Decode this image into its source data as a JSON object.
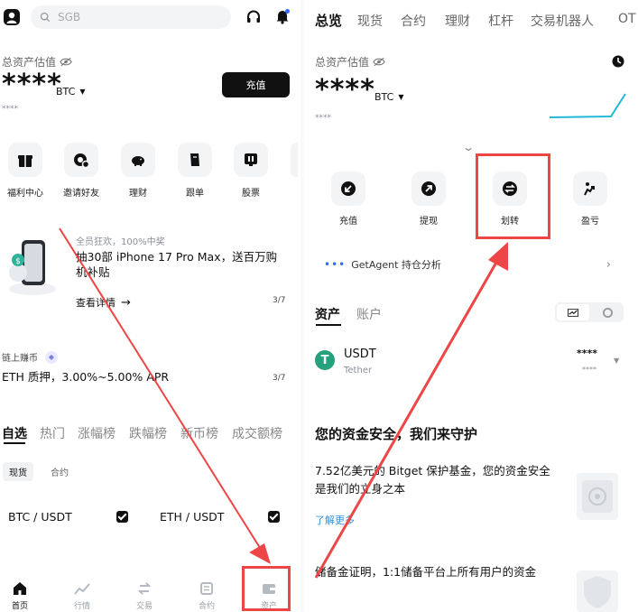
{
  "left": {
    "search_placeholder": "SGB",
    "total_label": "总资产估值",
    "balance_mask": "****",
    "currency": "BTC",
    "sub_mask": "****",
    "deposit_button": "充值",
    "quick_actions": [
      {
        "label": "福利中心",
        "icon": "gift-icon"
      },
      {
        "label": "邀请好友",
        "icon": "invite-icon"
      },
      {
        "label": "理财",
        "icon": "piggy-bank-icon"
      },
      {
        "label": "跟单",
        "icon": "copy-trade-icon"
      },
      {
        "label": "股票",
        "icon": "stock-icon"
      }
    ],
    "promo": {
      "kicker": "全员狂欢，100%中奖",
      "title": "抽30部 iPhone 17 Pro Max，送百万购机补贴",
      "link": "查看详情",
      "page": "3/7"
    },
    "earn": {
      "label": "链上赚币",
      "text": "ETH 质押，3.00%~5.00% APR",
      "page": "3/7"
    },
    "market_tabs": [
      "自选",
      "热门",
      "涨幅榜",
      "跌幅榜",
      "新币榜",
      "成交额榜"
    ],
    "sub_tabs": [
      "现货",
      "合约"
    ],
    "watch_pairs": [
      "BTC / USDT",
      "ETH / USDT"
    ],
    "bottom_nav": [
      {
        "label": "首页",
        "icon": "home-icon"
      },
      {
        "label": "行情",
        "icon": "market-icon"
      },
      {
        "label": "交易",
        "icon": "trade-icon"
      },
      {
        "label": "合约",
        "icon": "futures-icon"
      },
      {
        "label": "资产",
        "icon": "wallet-icon"
      }
    ]
  },
  "right": {
    "top_tabs": [
      "总览",
      "现货",
      "合约",
      "理财",
      "杠杆",
      "交易机器人",
      "OT"
    ],
    "total_label": "总资产估值",
    "balance_mask": "****",
    "currency": "BTC",
    "sub_mask": "****",
    "actions": [
      {
        "label": "充值",
        "icon": "deposit-icon"
      },
      {
        "label": "提现",
        "icon": "withdraw-icon"
      },
      {
        "label": "划转",
        "icon": "transfer-icon"
      },
      {
        "label": "盈亏",
        "icon": "pnl-icon"
      }
    ],
    "agent_text": "GetAgent 持仓分析",
    "asset_tabs": [
      "资产",
      "账户"
    ],
    "coin": {
      "symbol": "USDT",
      "name": "Tether",
      "amount": "****",
      "value": "****"
    },
    "safety_title": "您的资金安全，我们来守护",
    "fund_text": "7.52亿美元的 Bitget 保护基金，您的资金安全是我们的立身之本",
    "learn_more": "了解更多",
    "reserve_text": "储备金证明，1:1储备平台上所有用户的资金"
  },
  "colors": {
    "accent_red": "#ee4646",
    "usdt_green": "#26a17b",
    "cyan_line": "#22b8d8"
  }
}
